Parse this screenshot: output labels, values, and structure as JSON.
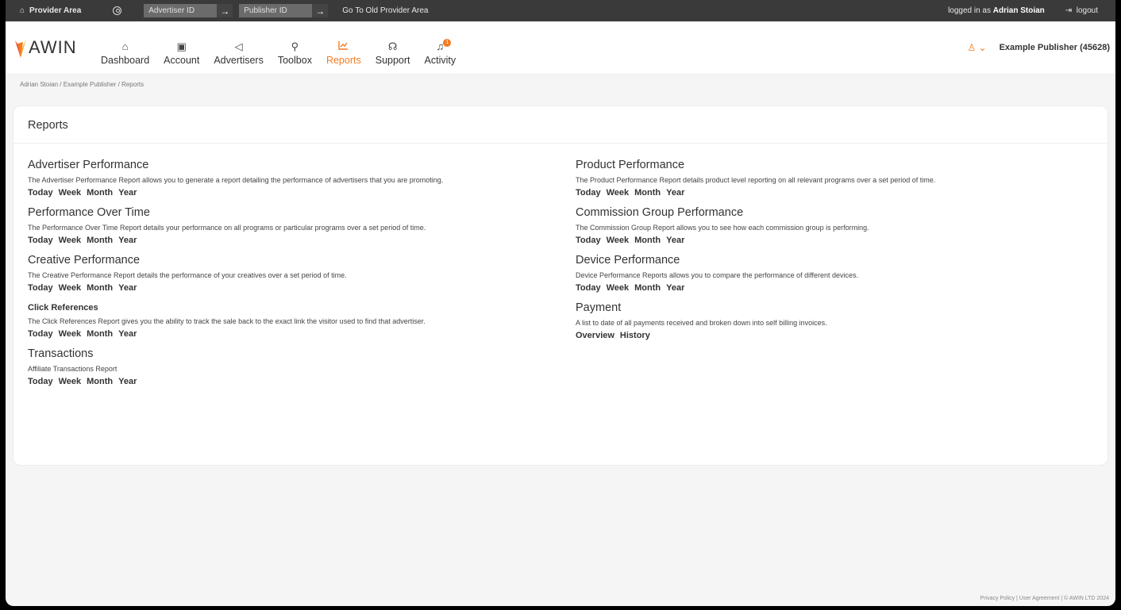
{
  "topbar": {
    "provider_label": "Provider Area",
    "advertiser_placeholder": "Advertiser ID",
    "publisher_placeholder": "Publisher ID",
    "old_area_label": "Go To Old Provider Area",
    "logged_in_prefix": "logged in as",
    "logged_in_user": "Adrian Stoian",
    "logout_label": "logout"
  },
  "header": {
    "logo_text": "AWIN",
    "nav": [
      {
        "label": "Dashboard",
        "icon": "home-icon"
      },
      {
        "label": "Account",
        "icon": "id-card-icon"
      },
      {
        "label": "Advertisers",
        "icon": "megaphone-icon"
      },
      {
        "label": "Toolbox",
        "icon": "wrench-icon"
      },
      {
        "label": "Reports",
        "icon": "chart-icon"
      },
      {
        "label": "Support",
        "icon": "headset-icon"
      },
      {
        "label": "Activity",
        "icon": "bell-icon",
        "badge": "1"
      }
    ],
    "active_nav": "Reports",
    "account_name": "Example Publisher (45628)"
  },
  "breadcrumb": "Adrian Stoian / Example Publisher / Reports",
  "card": {
    "title": "Reports",
    "left": [
      {
        "title": "Advertiser Performance",
        "desc": "The Advertiser Performance Report allows you to generate a report detailing the performance of advertisers that you are promoting.",
        "links": [
          "Today",
          "Week",
          "Month",
          "Year"
        ]
      },
      {
        "title": "Performance Over Time",
        "desc": "The Performance Over Time Report details your performance on all programs or particular programs over a set period of time.",
        "links": [
          "Today",
          "Week",
          "Month",
          "Year"
        ]
      },
      {
        "title": "Creative Performance",
        "desc": "The Creative Performance Report details the performance of your creatives over a set period of time.",
        "links": [
          "Today",
          "Week",
          "Month",
          "Year"
        ]
      },
      {
        "title": "Click References",
        "small": true,
        "desc": "The Click References Report gives you the ability to track the sale back to the exact link the visitor used to find that advertiser.",
        "links": [
          "Today",
          "Week",
          "Month",
          "Year"
        ]
      },
      {
        "title": "Transactions",
        "desc": "Affiliate Transactions Report",
        "links": [
          "Today",
          "Week",
          "Month",
          "Year"
        ]
      }
    ],
    "right": [
      {
        "title": "Product Performance",
        "desc": "The Product Performance Report details product level reporting on all relevant programs over a set period of time.",
        "links": [
          "Today",
          "Week",
          "Month",
          "Year"
        ]
      },
      {
        "title": "Commission Group Performance",
        "desc": "The Commission Group Report allows you to see how each commission group is performing.",
        "links": [
          "Today",
          "Week",
          "Month",
          "Year"
        ]
      },
      {
        "title": "Device Performance",
        "desc": "Device Performance Reports allows you to compare the performance of different devices.",
        "links": [
          "Today",
          "Week",
          "Month",
          "Year"
        ]
      },
      {
        "title": "Payment",
        "desc": "A list to date of all payments received and broken down into self billing invoices.",
        "links": [
          "Overview",
          "History"
        ]
      }
    ]
  },
  "footer": "Privacy Policy | User Agreement | © AWIN LTD 2024",
  "colors": {
    "accent": "#f47b20",
    "topbar": "#3a3a3a"
  }
}
